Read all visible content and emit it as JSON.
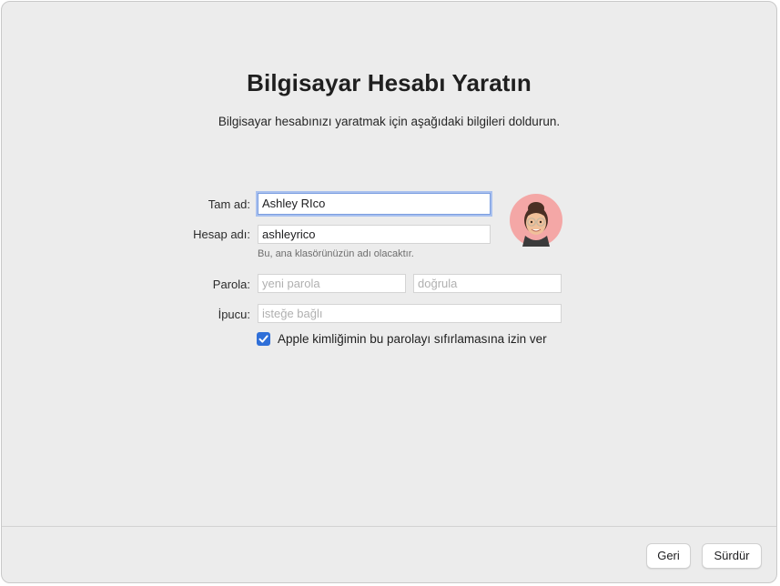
{
  "header": {
    "title": "Bilgisayar Hesabı Yaratın",
    "subtitle": "Bilgisayar hesabınızı yaratmak için aşağıdaki bilgileri doldurun."
  },
  "form": {
    "full_name_label": "Tam ad:",
    "full_name_value": "Ashley RIco",
    "account_name_label": "Hesap adı:",
    "account_name_value": "ashleyrico",
    "account_name_hint": "Bu, ana klasörünüzün adı olacaktır.",
    "password_label": "Parola:",
    "password_placeholder": "yeni parola",
    "verify_placeholder": "doğrula",
    "hint_label": "İpucu:",
    "hint_placeholder": "isteğe bağlı",
    "apple_id_reset_label": "Apple kimliğimin bu parolayı sıfırlamasına izin ver",
    "apple_id_reset_checked": true
  },
  "avatar": {
    "icon": "memoji-avatar-icon"
  },
  "footer": {
    "back_label": "Geri",
    "continue_label": "Sürdür"
  },
  "colors": {
    "accent": "#2f6fd8",
    "focus_ring": "#a9c1ef",
    "avatar_bg": "#f4a7a6",
    "window_bg": "#ececec"
  }
}
